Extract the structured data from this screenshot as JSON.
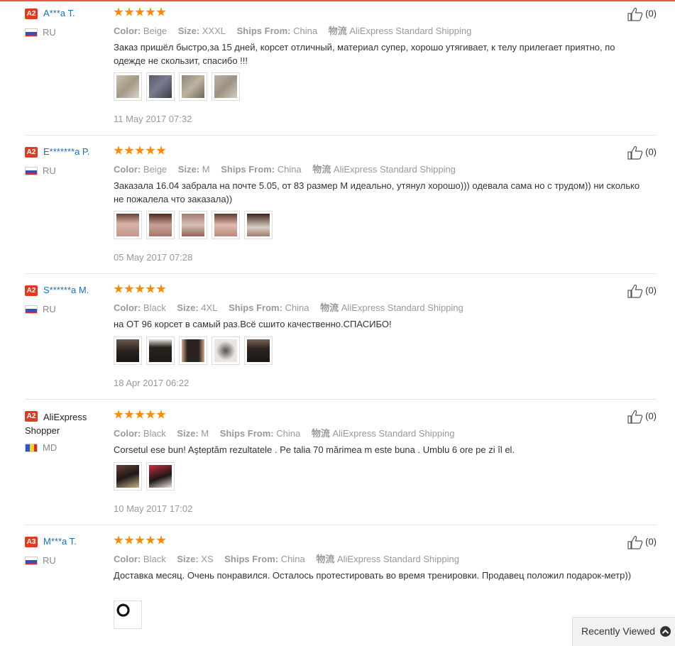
{
  "labels": {
    "color": "Color:",
    "size": "Size:",
    "ships_from": "Ships From:",
    "logistics": "物流"
  },
  "reviews": [
    {
      "level": "A2",
      "user": "A***a T.",
      "country": "RU",
      "rating": 5,
      "color": "Beige",
      "size": "XXXL",
      "ships_from": "China",
      "shipping": "AliExpress Standard Shipping",
      "text": "Заказ пришёл быстро,за 15 дней, корсет отличный, материал супер, хорошо утягивает, к телу прилегает приятно, по одежде не скользит, спасибо !!!",
      "date": "11 May 2017 07:32",
      "helpful": "(0)"
    },
    {
      "level": "A2",
      "user": "E*******a P.",
      "country": "RU",
      "rating": 5,
      "color": "Beige",
      "size": "M",
      "ships_from": "China",
      "shipping": "AliExpress Standard Shipping",
      "text": "Заказала 16.04 забрала на почте 5.05, от 83 размер М идеально, утянул хорошо))) одевала сама но с трудом)) ни сколько не пожалела что заказала))",
      "date": "05 May 2017 07:28",
      "helpful": "(0)"
    },
    {
      "level": "A2",
      "user": "S******a M.",
      "country": "RU",
      "rating": 5,
      "color": "Black",
      "size": "4XL",
      "ships_from": "China",
      "shipping": "AliExpress Standard Shipping",
      "text": "на ОТ 96 корсет в самый раз.Всё сшито качественно.СПАСИБО!",
      "date": "18 Apr 2017 06:22",
      "helpful": "(0)"
    },
    {
      "level": "A2",
      "user": "AliExpress Shopper",
      "country": "MD",
      "rating": 5,
      "color": "Black",
      "size": "M",
      "ships_from": "China",
      "shipping": "AliExpress Standard Shipping",
      "text": "Corsetul ese bun! Aşteptăm rezultatele . Pe talia 70 mărimea m este buna . Umblu 6 ore pe zi îl el.",
      "date": "10 May 2017 17:02",
      "helpful": "(0)"
    },
    {
      "level": "A3",
      "user": "M***a T.",
      "country": "RU",
      "rating": 5,
      "color": "Black",
      "size": "XS",
      "ships_from": "China",
      "shipping": "AliExpress Standard Shipping",
      "text": "Доставка месяц. Очень понравился. Осталось протестировать во время тренировки. Продавец положил подарок-метр))",
      "date": "",
      "helpful": "(0)"
    }
  ],
  "recently_viewed": {
    "label": "Recently Viewed",
    "icon": "chevron-up-icon"
  },
  "colors": {
    "accent": "#e23a1e",
    "star": "#ff8a00",
    "link": "#1a6dbb"
  }
}
